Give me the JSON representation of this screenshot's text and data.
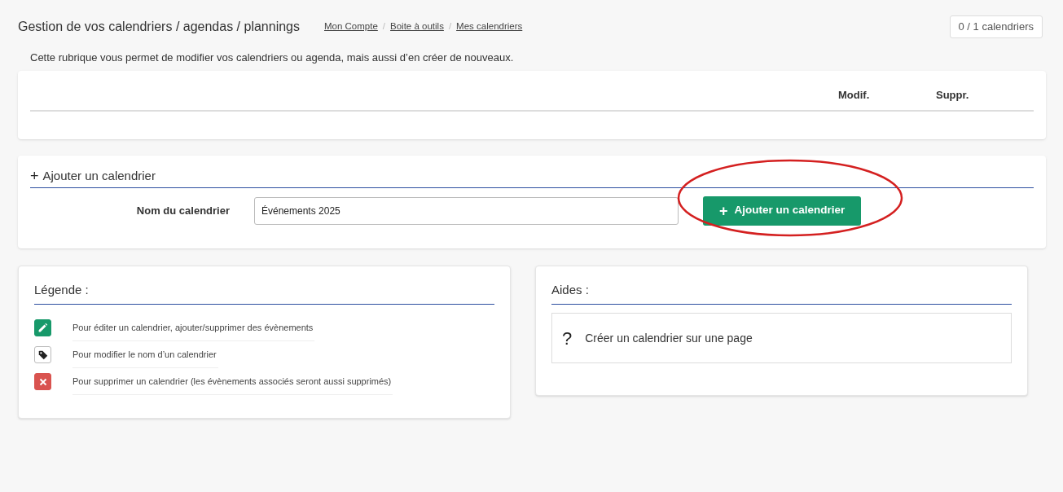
{
  "header": {
    "title": "Gestion de vos calendriers / agendas / plannings",
    "breadcrumbs": [
      "Mon Compte",
      "Boite à outils",
      "Mes calendriers"
    ],
    "breadcrumb_separator": "/",
    "counter": "0 / 1 calendriers"
  },
  "description": "Cette rubrique vous permet de modifier vos calendriers ou agenda, mais aussi d’en créer de nouveaux.",
  "table": {
    "columns": [
      "Modif.",
      "Suppr."
    ]
  },
  "add_form": {
    "heading_icon": "+",
    "heading": "Ajouter un calendrier",
    "label": "Nom du calendrier",
    "value": "Événements 2025",
    "button_icon": "+",
    "button": "Ajouter un calendrier",
    "highlighted": true
  },
  "legend": {
    "title": "Légende :",
    "items": [
      {
        "kind": "edit",
        "text": "Pour éditer un calendrier, ajouter/supprimer des évènements"
      },
      {
        "kind": "tag",
        "text": "Pour modifier le nom d’un calendrier"
      },
      {
        "kind": "delete",
        "text": "Pour supprimer un calendrier (les évènements associés seront aussi supprimés)"
      }
    ]
  },
  "help": {
    "title": "Aides :",
    "items": [
      {
        "icon": "?",
        "text": "Créer un calendrier sur une page"
      }
    ]
  }
}
